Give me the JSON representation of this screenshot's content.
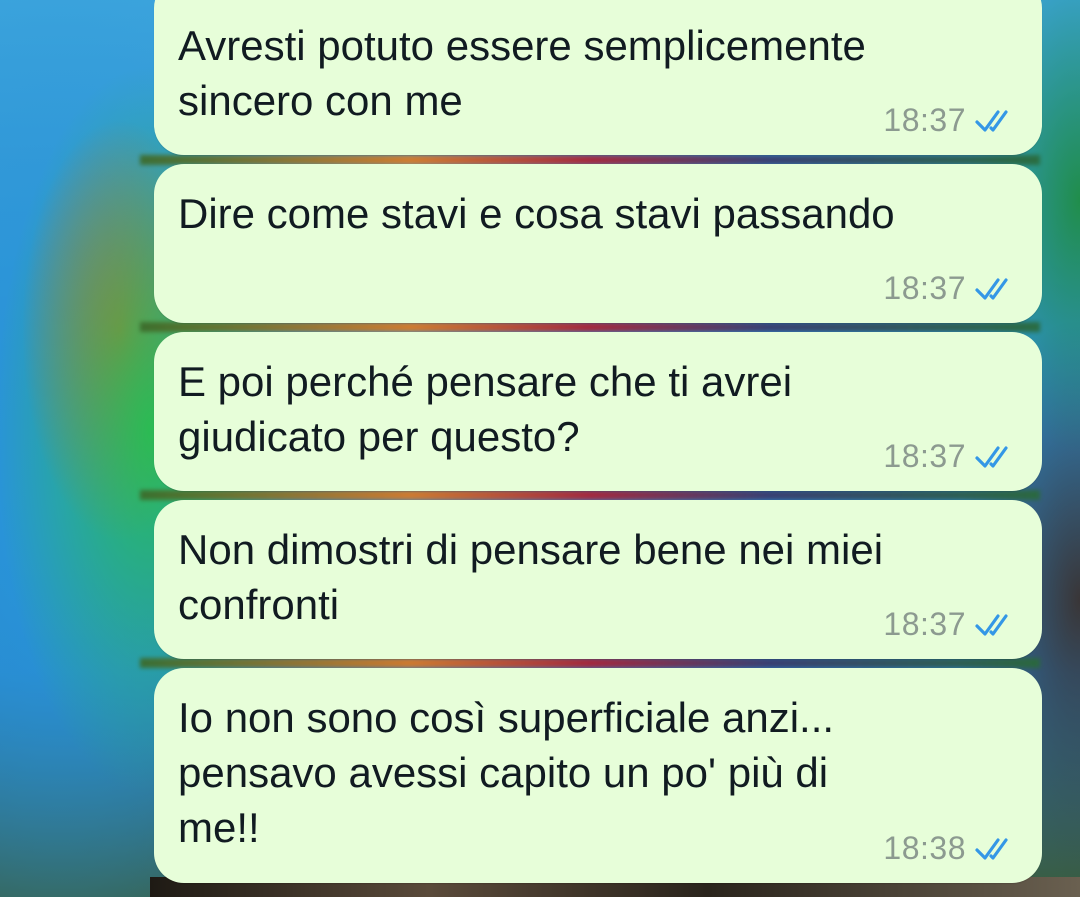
{
  "colors": {
    "bubble": "#e7fed9",
    "text": "#111b21",
    "timestamp": "#8c9a90",
    "read_ticks": "#3497e6"
  },
  "messages": [
    {
      "text": "Avresti potuto essere semplicemente\nsincero con me",
      "time": "18:37",
      "status_icon": "double-check-read-icon"
    },
    {
      "text": "Dire come stavi e cosa stavi passando",
      "time": "18:37",
      "status_icon": "double-check-read-icon"
    },
    {
      "text": "E poi perché pensare che ti avrei\ngiudicato per questo?",
      "time": "18:37",
      "status_icon": "double-check-read-icon"
    },
    {
      "text": "Non dimostri di pensare bene nei miei\nconfronti",
      "time": "18:37",
      "status_icon": "double-check-read-icon"
    },
    {
      "text": "Io non sono così superficiale anzi...\npensavo avessi capito un po' più di\nme!!",
      "time": "18:38",
      "status_icon": "double-check-read-icon"
    }
  ]
}
